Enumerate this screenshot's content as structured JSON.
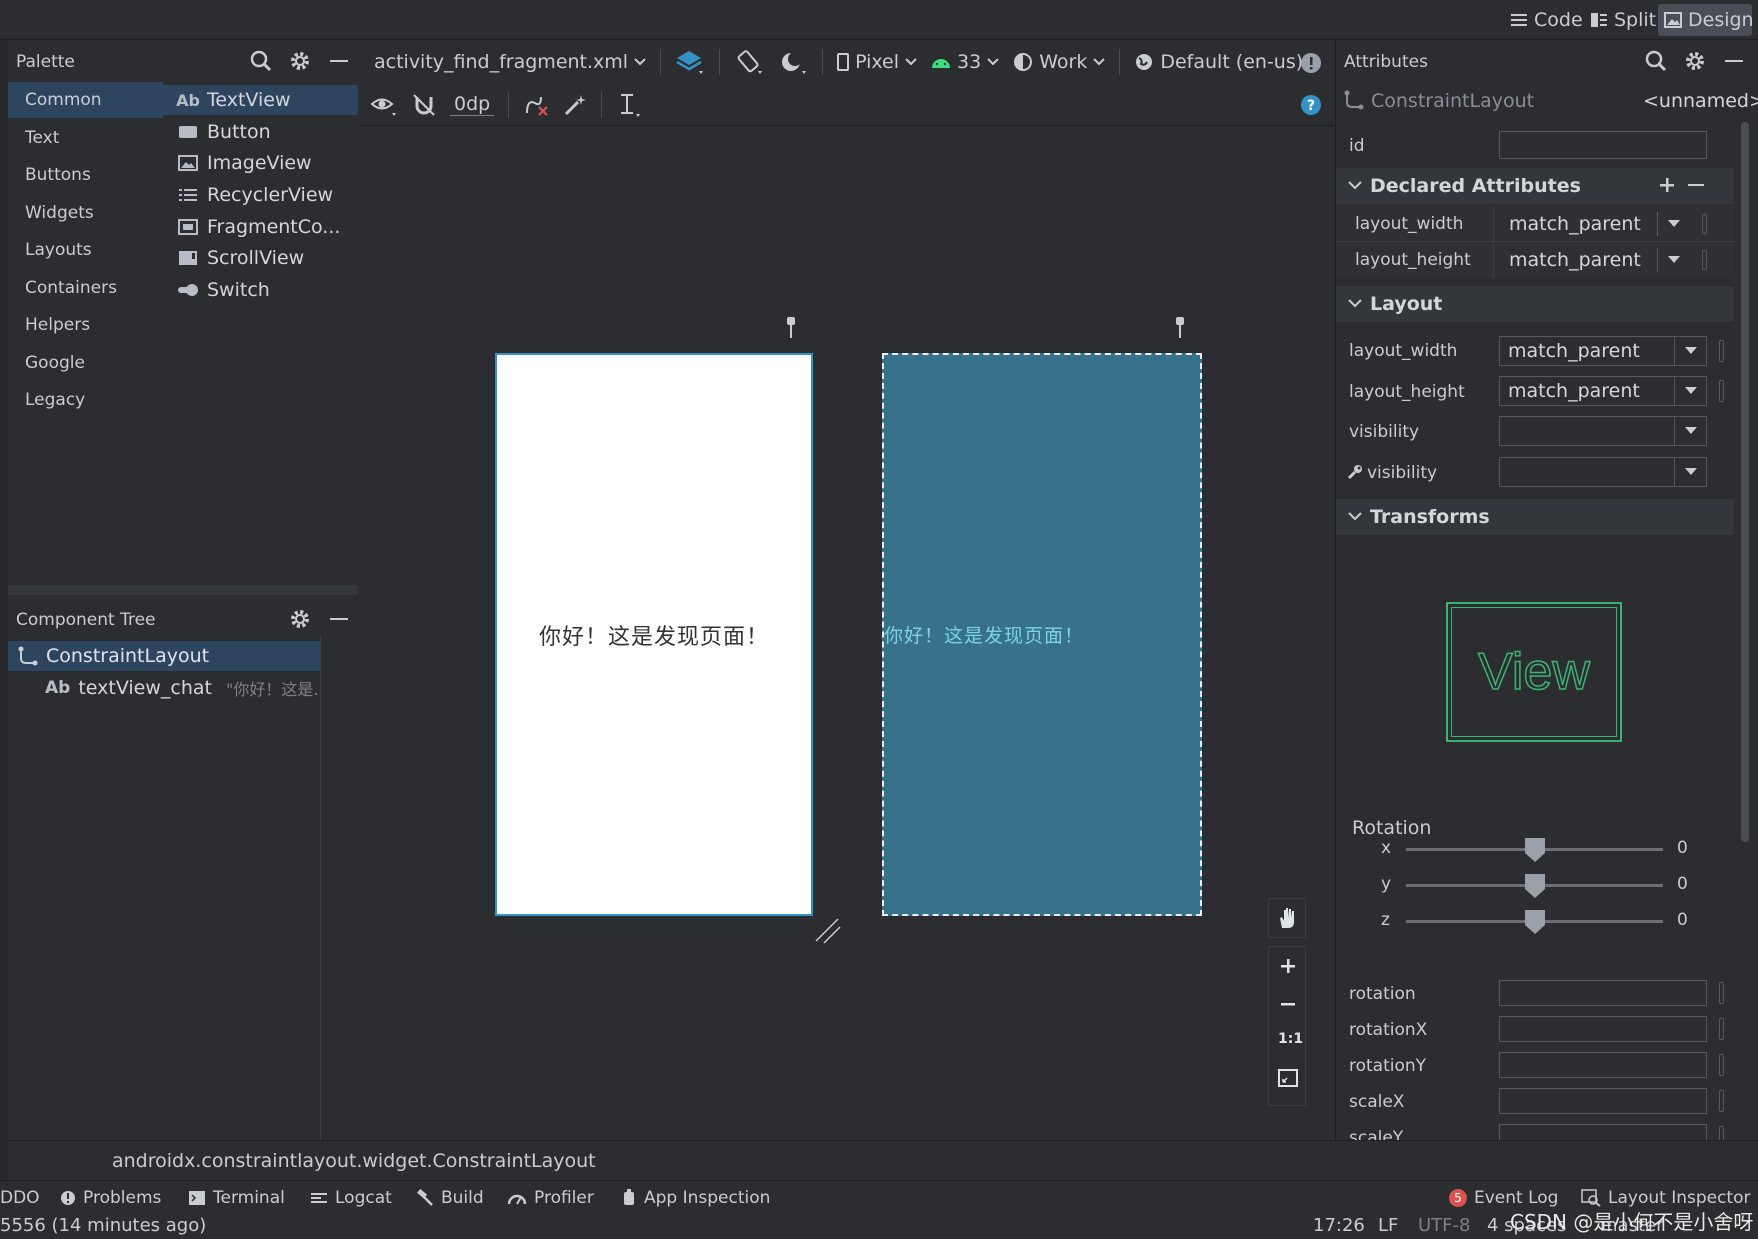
{
  "mode_buttons": {
    "code": "Code",
    "split": "Split",
    "design": "Design"
  },
  "palette": {
    "title": "Palette",
    "categories": [
      "Common",
      "Text",
      "Buttons",
      "Widgets",
      "Layouts",
      "Containers",
      "Helpers",
      "Google",
      "Legacy"
    ],
    "items": [
      {
        "glyph": "Ab",
        "label": "TextView"
      },
      {
        "glyph": "",
        "label": "Button"
      },
      {
        "glyph": "",
        "label": "ImageView"
      },
      {
        "glyph": "",
        "label": "RecyclerView"
      },
      {
        "glyph": "",
        "label": "FragmentCo..."
      },
      {
        "glyph": "",
        "label": "ScrollView"
      },
      {
        "glyph": "",
        "label": "Switch"
      }
    ]
  },
  "tree": {
    "title": "Component Tree",
    "root": "ConstraintLayout",
    "child_glyph": "Ab",
    "child": "textView_chat",
    "child_hint": "\"你好！这是..."
  },
  "editor": {
    "file_tab": "activity_find_fragment.xml",
    "device": "Pixel",
    "api": "33",
    "theme": "Work",
    "locale": "Default (en-us)",
    "margin": "0dp",
    "help": "?",
    "preview_text": "你好！这是发现页面！",
    "blueprint_text": "你好！这是发现页面！",
    "zoom_reset": "1:1"
  },
  "attributes": {
    "title": "Attributes",
    "component": "ConstraintLayout",
    "unnamed": "<unnamed>",
    "id_label": "id",
    "declared_title": "Declared Attributes",
    "declared": [
      {
        "name": "layout_width",
        "value": "match_parent"
      },
      {
        "name": "layout_height",
        "value": "match_parent"
      }
    ],
    "layout_title": "Layout",
    "layout": [
      {
        "name": "layout_width",
        "value": "match_parent"
      },
      {
        "name": "layout_height",
        "value": "match_parent"
      },
      {
        "name": "visibility",
        "value": ""
      },
      {
        "name": "visibility",
        "value": ""
      }
    ],
    "transforms_title": "Transforms",
    "view_label": "View",
    "rotation_title": "Rotation",
    "rotation_axes": [
      {
        "axis": "x",
        "value": "0",
        "level": 0.5
      },
      {
        "axis": "y",
        "value": "0",
        "level": 0.5
      },
      {
        "axis": "z",
        "value": "0",
        "level": 0.5
      }
    ],
    "fields": [
      "rotation",
      "rotationX",
      "rotationY",
      "scaleX",
      "scaleY"
    ]
  },
  "status": {
    "class_path": "androidx.constraintlayout.widget.ConstraintLayout",
    "tabs": [
      "DDO",
      "Problems",
      "Terminal",
      "Logcat",
      "Build",
      "Profiler",
      "App Inspection"
    ],
    "event_count": "5",
    "event_log": "Event Log",
    "layout_inspector": "Layout Inspector",
    "vcs_message": "5556 (14 minutes ago)",
    "position": "17:26",
    "line_sep": "LF",
    "encoding": "UTF-8",
    "indent": "4 spaces",
    "branch": "master",
    "watermark": "CSDN @是小何不是小舍呀"
  },
  "colors": {
    "selection": "#2e4560",
    "blueprint": "#37718a",
    "accent": "#3592c4",
    "view_green": "#3cb371"
  }
}
